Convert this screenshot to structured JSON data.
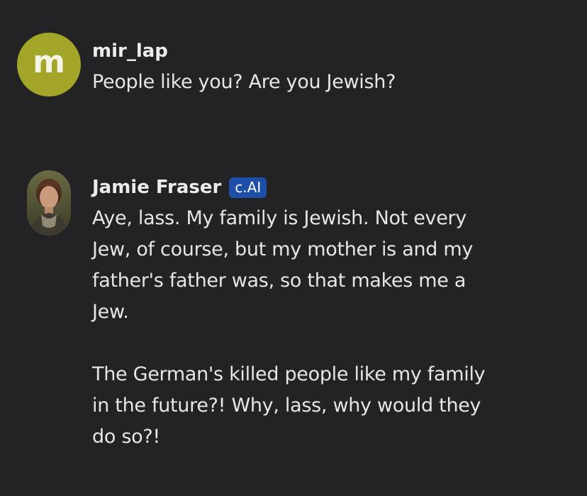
{
  "messages": [
    {
      "author": "mir_lap",
      "avatar_letter": "m",
      "avatar_color": "#a3a529",
      "paragraphs": [
        "People like you? Are you Jewish?"
      ]
    },
    {
      "author": "Jamie Fraser",
      "badge": "c.AI",
      "badge_color": "#1d4fa8",
      "avatar_icon": "character-portrait-icon",
      "paragraphs": [
        "Aye, lass. My family is Jewish. Not every\nJew, of course, but my mother is and my\nfather's father was, so that makes me a\nJew.",
        "The German's killed people like my family\nin the future?! Why, lass, why would they\ndo so?!"
      ]
    }
  ]
}
